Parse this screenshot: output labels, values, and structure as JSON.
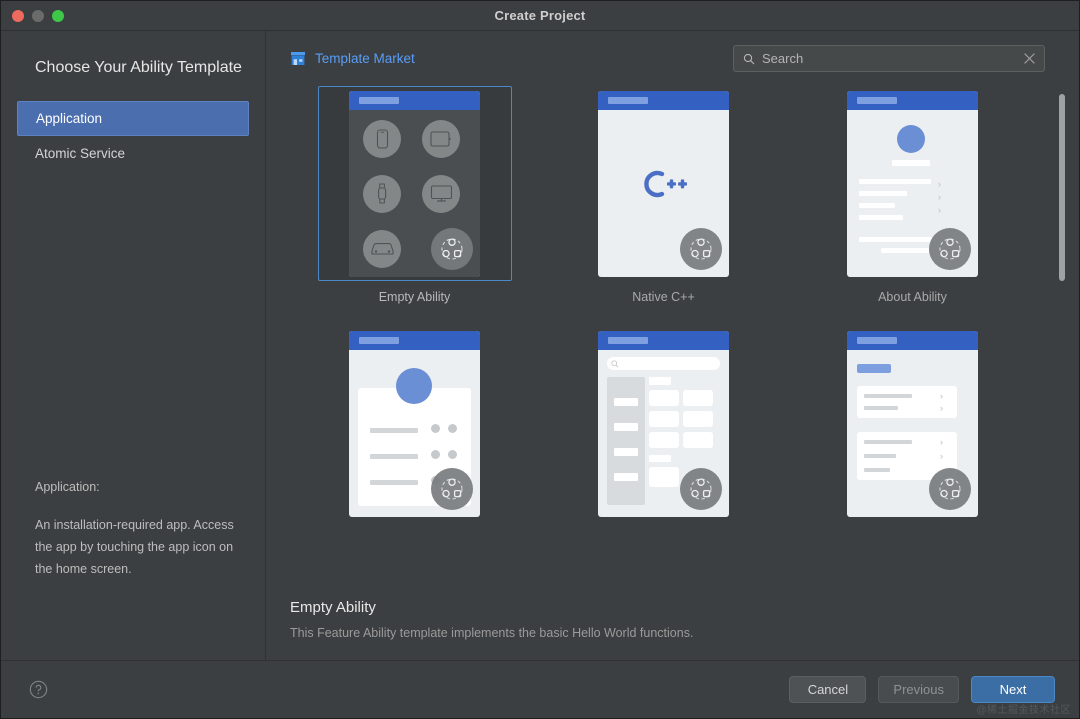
{
  "window": {
    "title": "Create Project",
    "traffic_lights": [
      "close-red",
      "minimize-gray",
      "zoom-green"
    ]
  },
  "left": {
    "heading": "Choose Your Ability Template",
    "items": [
      {
        "label": "Application",
        "selected": true
      },
      {
        "label": "Atomic Service",
        "selected": false
      }
    ],
    "description_label": "Application:",
    "description_text": "An installation-required app. Access the app by touching the app icon on the home screen."
  },
  "toolbar": {
    "market_link": "Template Market",
    "market_icon": "store-icon",
    "search_placeholder": "Search",
    "search_value": "",
    "search_icon": "search-icon",
    "clear_icon": "close-icon"
  },
  "templates": [
    {
      "label": "Empty Ability",
      "style": "devices",
      "selected": true
    },
    {
      "label": "Native C++",
      "style": "cpp",
      "selected": false
    },
    {
      "label": "About Ability",
      "style": "about",
      "selected": false
    },
    {
      "label": "",
      "style": "profile",
      "selected": false
    },
    {
      "label": "",
      "style": "catalog",
      "selected": false
    },
    {
      "label": "",
      "style": "settings",
      "selected": false
    }
  ],
  "selection": {
    "title": "Empty Ability",
    "subtitle": "This Feature Ability template implements the basic Hello World functions."
  },
  "footer": {
    "help_icon": "help-circle-icon",
    "cancel_label": "Cancel",
    "previous_label": "Previous",
    "next_label": "Next",
    "watermark": "@稀土掘金技术社区"
  },
  "colors": {
    "accent_blue": "#3a6ea5",
    "link_blue": "#589df6",
    "selection_blue": "#4b6eaf",
    "window_bg": "#3c3f41",
    "thumb_header": "#3461c1"
  }
}
